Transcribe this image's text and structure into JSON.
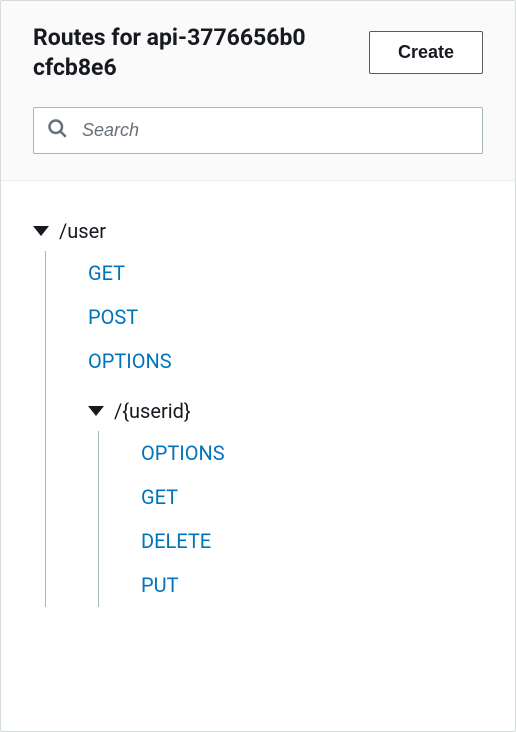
{
  "header": {
    "title": "Routes for api-3776656b0cfcb8e6",
    "create_label": "Create"
  },
  "search": {
    "placeholder": "Search"
  },
  "tree": {
    "root": {
      "label": "/user",
      "methods": {
        "m0": "GET",
        "m1": "POST",
        "m2": "OPTIONS"
      },
      "child": {
        "label": "/{userid}",
        "methods": {
          "m0": "OPTIONS",
          "m1": "GET",
          "m2": "DELETE",
          "m3": "PUT"
        }
      }
    }
  }
}
